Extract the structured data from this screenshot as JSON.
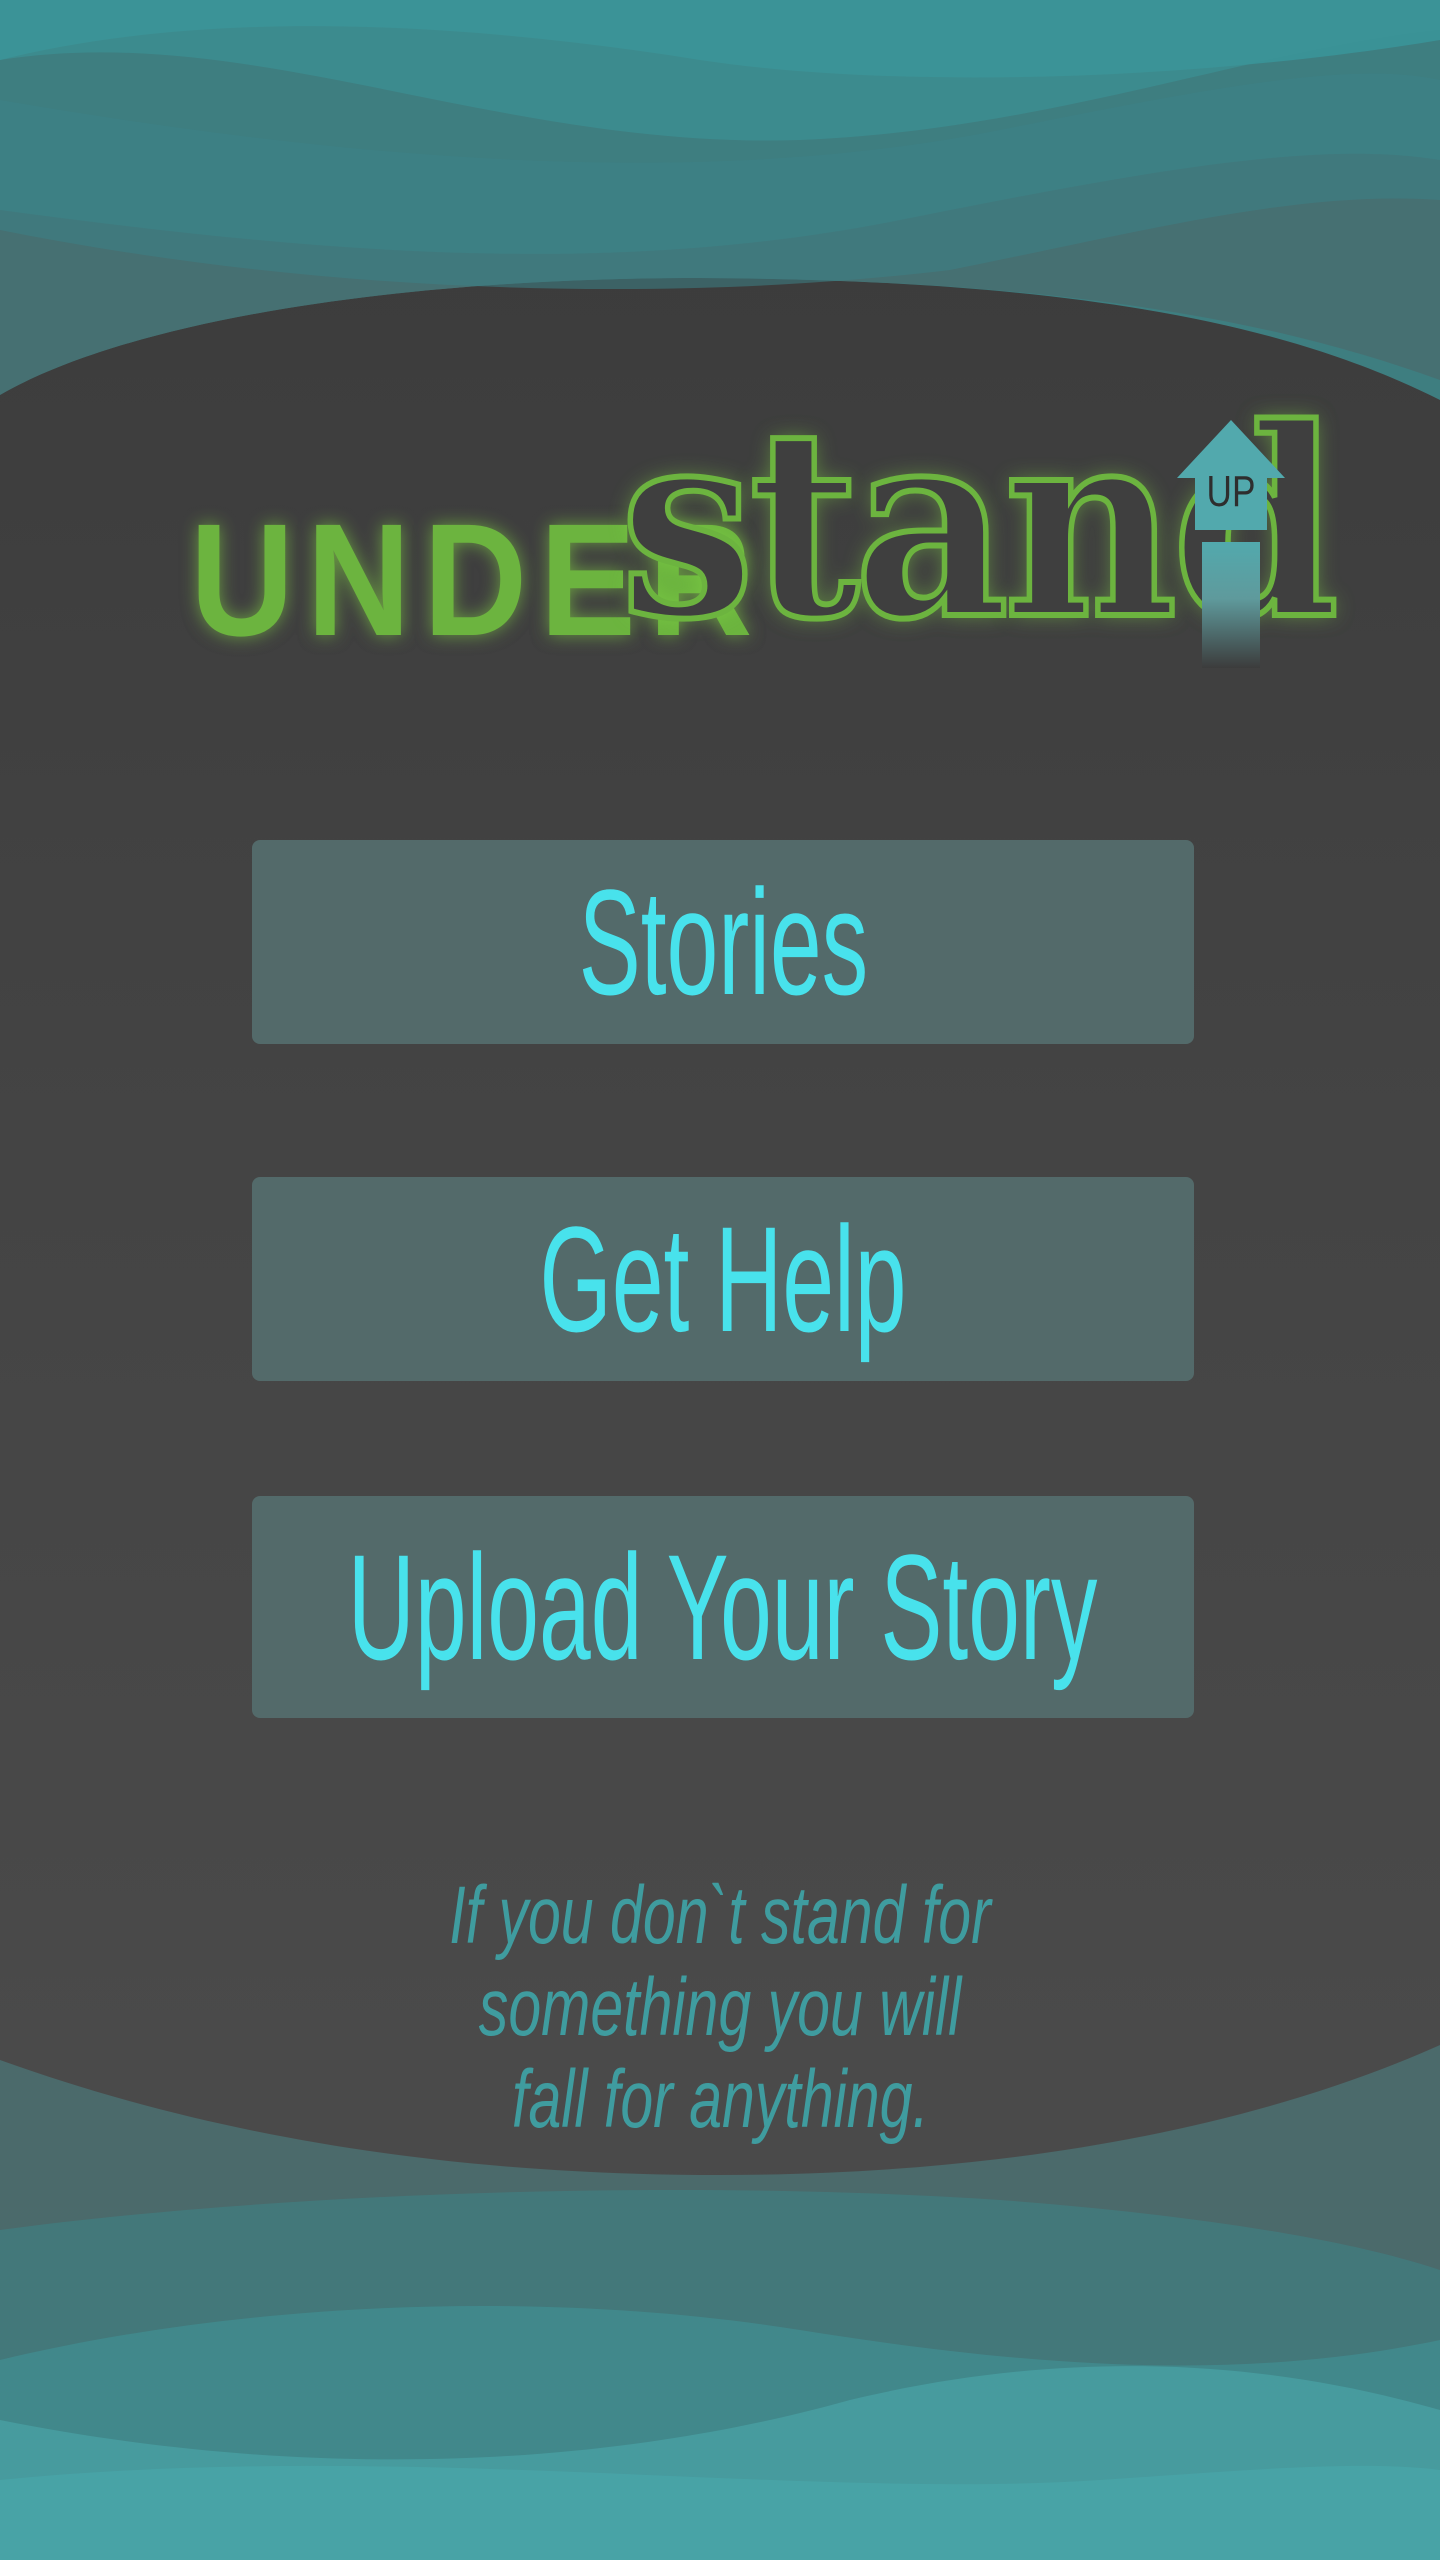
{
  "logo": {
    "under_text": "UNDER",
    "stand_text": "stand",
    "up_text": "UP",
    "up_icon": "up-arrow-icon"
  },
  "menu": {
    "stories_label": "Stories",
    "get_help_label": "Get Help",
    "upload_label": "Upload Your Story"
  },
  "quote": {
    "line1": "If you don`t stand for something you will",
    "line2": "fall for anything."
  },
  "colors": {
    "background": "#444444",
    "accent_green": "#6cb43f",
    "accent_teal": "#48e2ec",
    "button_bg": "#536a6a",
    "wave_teal": "#3f9ea1"
  }
}
